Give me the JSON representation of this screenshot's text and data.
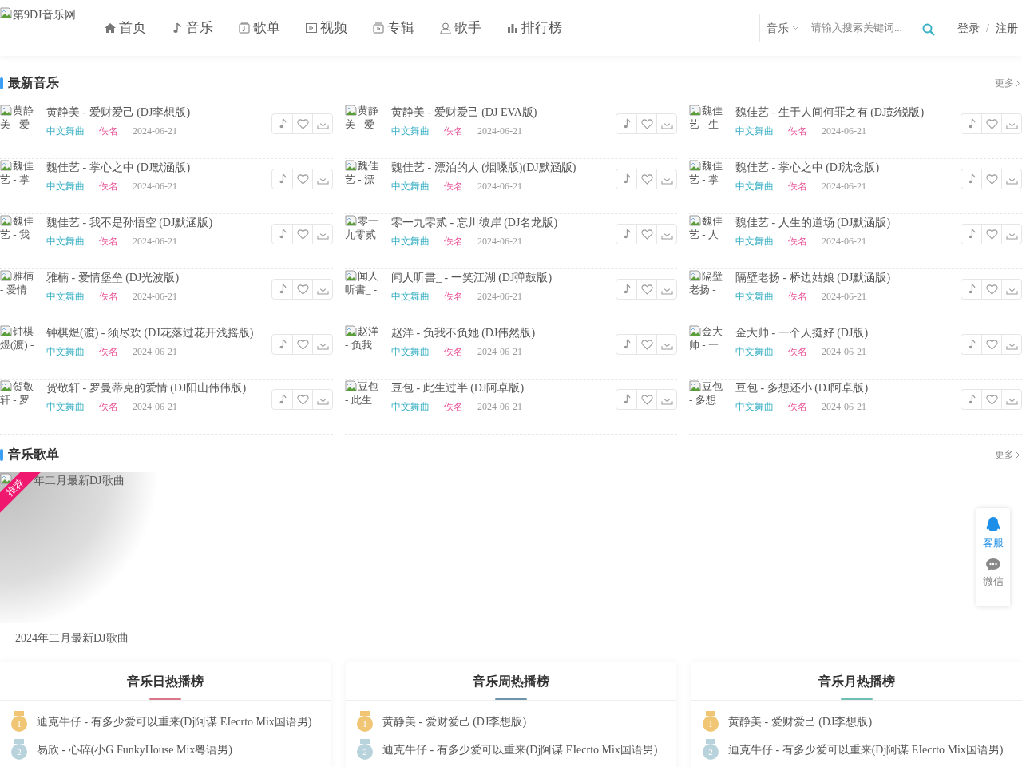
{
  "header": {
    "logo_alt": "第9DJ音乐网",
    "nav": [
      {
        "kind": "home",
        "label": "首页"
      },
      {
        "kind": "note",
        "label": "音乐"
      },
      {
        "kind": "playlist",
        "label": "歌单"
      },
      {
        "kind": "video",
        "label": "视频"
      },
      {
        "kind": "album",
        "label": "专辑"
      },
      {
        "kind": "singer",
        "label": "歌手"
      },
      {
        "kind": "chart",
        "label": "排行榜"
      }
    ],
    "search": {
      "category": "音乐",
      "placeholder": "请输入搜索关键词..."
    },
    "login": "登录",
    "separator": "/",
    "register": "注册"
  },
  "latest": {
    "title": "最新音乐",
    "more": "更多",
    "columns": [
      [
        {
          "thumb": "黄静美 - 爱",
          "title": "黄静美 - 爱财爱己 (DJ李想版)",
          "genre": "中文舞曲",
          "artist": "佚名",
          "date": "2024-06-21"
        },
        {
          "thumb": "魏佳艺 - 掌",
          "title": "魏佳艺 - 掌心之中 (DJ默涵版)",
          "genre": "中文舞曲",
          "artist": "佚名",
          "date": "2024-06-21"
        },
        {
          "thumb": "魏佳艺 - 我",
          "title": "魏佳艺 - 我不是孙悟空 (DJ默涵版)",
          "genre": "中文舞曲",
          "artist": "佚名",
          "date": "2024-06-21"
        },
        {
          "thumb": "雅楠 - 爱情",
          "title": "雅楠 - 爱情堡垒 (DJ光波版)",
          "genre": "中文舞曲",
          "artist": "佚名",
          "date": "2024-06-21"
        },
        {
          "thumb": "钟棋煜(渡) -",
          "title": "钟棋煜(渡) - 须尽欢 (DJ花落过花开浅摇版)",
          "genre": "中文舞曲",
          "artist": "佚名",
          "date": "2024-06-21"
        },
        {
          "thumb": "贺敬轩 - 罗",
          "title": "贺敬轩 - 罗曼蒂克的爱情 (DJ阳山伟伟版)",
          "genre": "中文舞曲",
          "artist": "佚名",
          "date": "2024-06-21"
        }
      ],
      [
        {
          "thumb": "黄静美 - 爱",
          "title": "黄静美 - 爱财爱己 (DJ EVA版)",
          "genre": "中文舞曲",
          "artist": "佚名",
          "date": "2024-06-21"
        },
        {
          "thumb": "魏佳艺 - 漂",
          "title": "魏佳艺 - 漂泊的人 (烟嗓版)(DJ默涵版)",
          "genre": "中文舞曲",
          "artist": "佚名",
          "date": "2024-06-21"
        },
        {
          "thumb": "零一九零贰",
          "title": "零一九零贰 - 忘川彼岸 (DJ名龙版)",
          "genre": "中文舞曲",
          "artist": "佚名",
          "date": "2024-06-21"
        },
        {
          "thumb": "闻人听書_ -",
          "title": "闻人听書_ - 一笑江湖 (DJ弹鼓版)",
          "genre": "中文舞曲",
          "artist": "佚名",
          "date": "2024-06-21"
        },
        {
          "thumb": "赵洋 - 负我",
          "title": "赵洋 - 负我不负她 (DJ伟然版)",
          "genre": "中文舞曲",
          "artist": "佚名",
          "date": "2024-06-21"
        },
        {
          "thumb": "豆包 - 此生",
          "title": "豆包 - 此生过半 (DJ阿卓版)",
          "genre": "中文舞曲",
          "artist": "佚名",
          "date": "2024-06-21"
        }
      ],
      [
        {
          "thumb": "魏佳艺 - 生",
          "title": "魏佳艺 - 生于人间何罪之有 (DJ彭锐版)",
          "genre": "中文舞曲",
          "artist": "佚名",
          "date": "2024-06-21"
        },
        {
          "thumb": "魏佳艺 - 掌",
          "title": "魏佳艺 - 掌心之中 (DJ沈念版)",
          "genre": "中文舞曲",
          "artist": "佚名",
          "date": "2024-06-21"
        },
        {
          "thumb": "魏佳艺 - 人",
          "title": "魏佳艺 - 人生的道场 (DJ默涵版)",
          "genre": "中文舞曲",
          "artist": "佚名",
          "date": "2024-06-21"
        },
        {
          "thumb": "隔壁老扬 -",
          "title": "隔壁老扬 - 桥边姑娘 (DJ默涵版)",
          "genre": "中文舞曲",
          "artist": "佚名",
          "date": "2024-06-21"
        },
        {
          "thumb": "金大帅 - 一",
          "title": "金大帅 - 一个人挺好 (DJ版)",
          "genre": "中文舞曲",
          "artist": "佚名",
          "date": "2024-06-21"
        },
        {
          "thumb": "豆包 - 多想",
          "title": "豆包 - 多想还小 (DJ阿卓版)",
          "genre": "中文舞曲",
          "artist": "佚名",
          "date": "2024-06-21"
        }
      ]
    ]
  },
  "playlists": {
    "title": "音乐歌单",
    "more": "更多",
    "items": [
      {
        "image_alt": "年二月最新DJ歌曲",
        "ribbon": "推荐",
        "caption": "2024年二月最新DJ歌曲"
      }
    ]
  },
  "rankings": [
    {
      "title": "音乐日热播榜",
      "color": "#d9788a",
      "entries": [
        {
          "rank": "1",
          "title": "迪克牛仔 - 有多少爱可以重来(Dj阿谋 EIecrto Mix国语男)"
        },
        {
          "rank": "2",
          "title": "易欣 - 心碎(小G FunkyHouse Mix粤语男)"
        }
      ]
    },
    {
      "title": "音乐周热播榜",
      "color": "#6e93ad",
      "entries": [
        {
          "rank": "1",
          "title": "黄静美 - 爱财爱己 (DJ李想版)"
        },
        {
          "rank": "2",
          "title": "迪克牛仔 - 有多少爱可以重来(Dj阿谋 EIecrto Mix国语男)"
        }
      ]
    },
    {
      "title": "音乐月热播榜",
      "color": "#6dbfb3",
      "entries": [
        {
          "rank": "1",
          "title": "黄静美 - 爱财爱己 (DJ李想版)"
        },
        {
          "rank": "2",
          "title": "迪克牛仔 - 有多少爱可以重来(Dj阿谋 EIecrto Mix国语男)"
        }
      ]
    }
  ],
  "float_panel": [
    {
      "kind": "qq",
      "label": "客服"
    },
    {
      "kind": "chat",
      "label": "微信"
    }
  ]
}
